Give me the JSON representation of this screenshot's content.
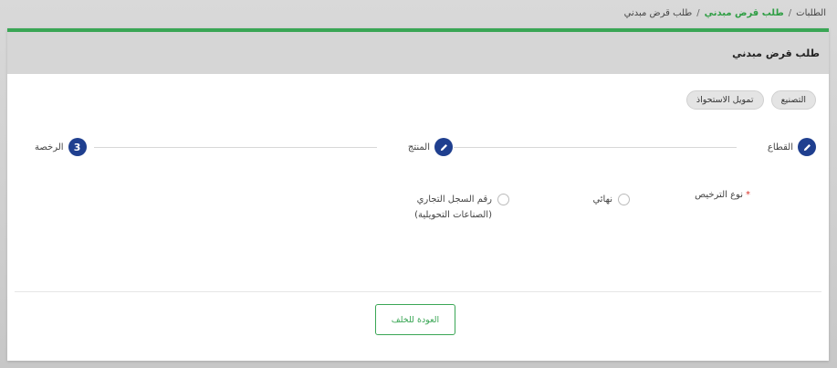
{
  "breadcrumb": {
    "root": "الطلبات",
    "active": "طلب قرض مبدني",
    "current": "طلب قرض مبدني",
    "separator": "/"
  },
  "card": {
    "title": "طلب قرض مبدني"
  },
  "chips": [
    {
      "label": "التصنيع"
    },
    {
      "label": "تمويل الاستحواذ"
    }
  ],
  "stepper": {
    "steps": [
      {
        "label": "القطاع",
        "icon": "pencil-icon"
      },
      {
        "label": "المنتج",
        "icon": "pencil-icon"
      },
      {
        "label": "الرخصة",
        "number": "3"
      }
    ]
  },
  "license_type": {
    "label": "نوع الترخيص",
    "required_marker": "*",
    "options": [
      {
        "label": "نهائي",
        "selected": false
      },
      {
        "label_line1": "رقم السجل التجاري",
        "label_line2": "(الصناعات التحويلية)",
        "selected": false
      }
    ]
  },
  "back_button": {
    "label": "العودة للخلف"
  },
  "colors": {
    "accent_green": "#3aa655",
    "step_blue": "#1f3f8f",
    "required_red": "#d9342b"
  }
}
